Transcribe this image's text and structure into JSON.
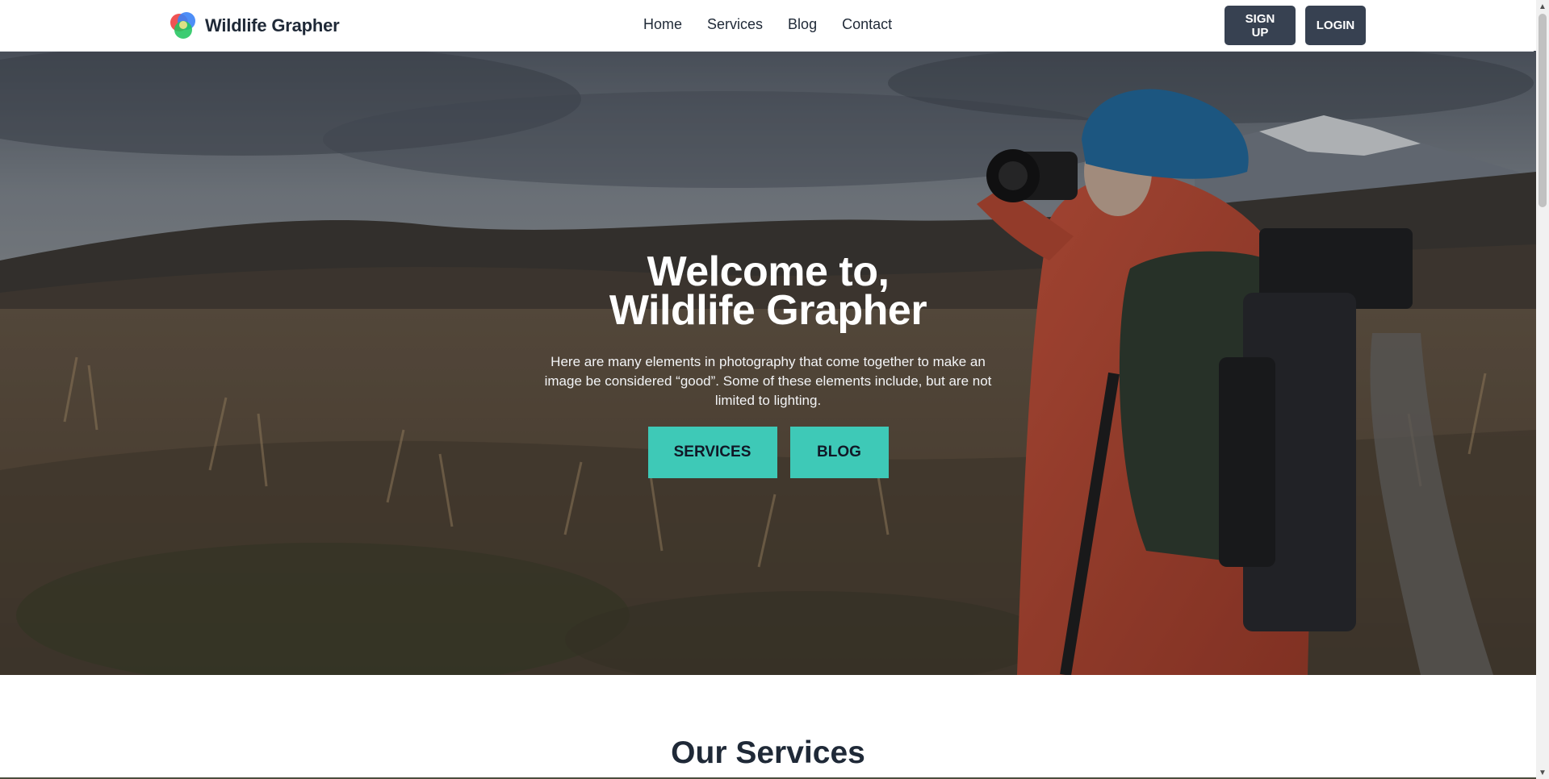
{
  "brand": {
    "name": "Wildlife Grapher",
    "colors": {
      "accent": "#3ec9b7",
      "dark_button": "#374151",
      "text": "#1f2937"
    }
  },
  "nav": {
    "items": [
      {
        "label": "Home"
      },
      {
        "label": "Services"
      },
      {
        "label": "Blog"
      },
      {
        "label": "Contact"
      }
    ]
  },
  "auth": {
    "signup_label": "SIGN UP",
    "login_label": "LOGIN"
  },
  "hero": {
    "title_line1": "Welcome to,",
    "title_line2": "Wildlife Grapher",
    "description": "Here are many elements in photography that come together to make an image be considered “good”. Some of these elements include, but are not limited to lighting.",
    "buttons": {
      "services_label": "SERVICES",
      "blog_label": "BLOG"
    },
    "background_image": "photographer with camera in grassy highland landscape"
  },
  "services_section": {
    "title": "Our Services"
  },
  "icons": {
    "logo": "logo-icon",
    "scroll_up": "chevron-up-icon",
    "scroll_down": "chevron-down-icon"
  }
}
